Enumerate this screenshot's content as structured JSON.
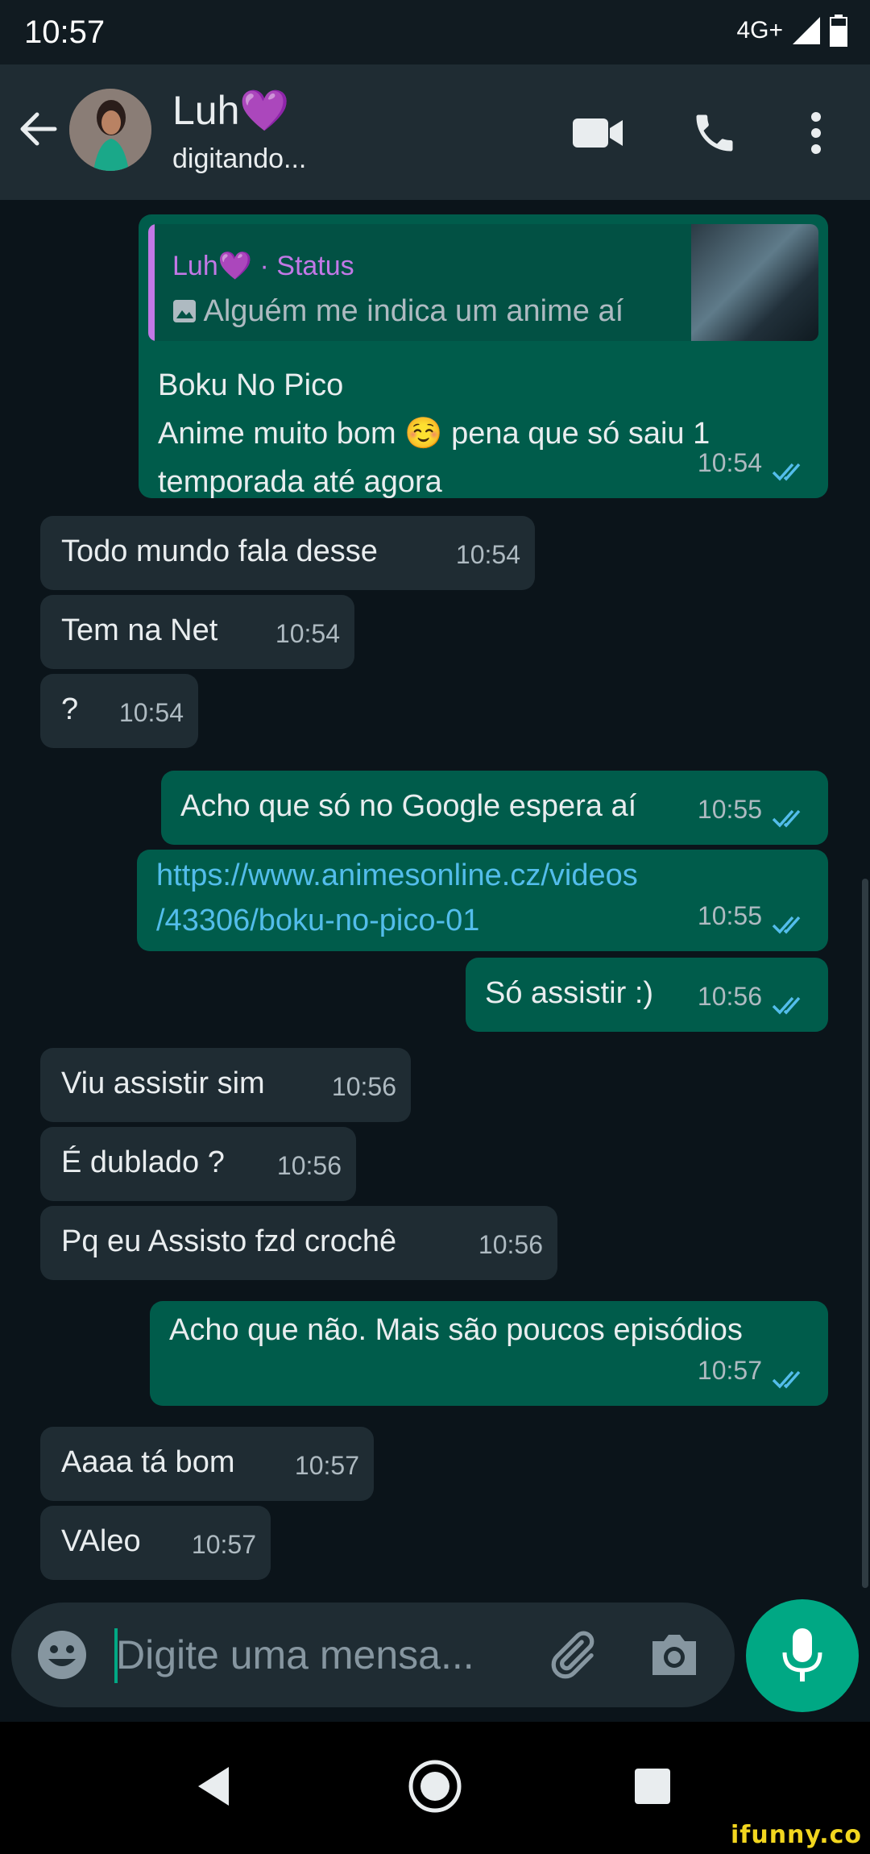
{
  "statusbar": {
    "time": "10:57",
    "network": "4G+"
  },
  "header": {
    "contact_name": "Luh💜",
    "contact_status": "digitando..."
  },
  "quote": {
    "author": "Luh💜 · Status",
    "text": "Alguém me indica um anime aí"
  },
  "messages": [
    {
      "dir": "out",
      "lines": [
        "Boku No Pico",
        "Anime muito bom ☺️ pena que só saiu 1",
        "temporada até agora"
      ],
      "time": "10:54"
    },
    {
      "dir": "in",
      "text": "Todo mundo fala desse",
      "time": "10:54"
    },
    {
      "dir": "in",
      "text": "Tem na Net",
      "time": "10:54"
    },
    {
      "dir": "in",
      "text": "?",
      "time": "10:54"
    },
    {
      "dir": "out",
      "text": "Acho que só no Google espera aí",
      "time": "10:55"
    },
    {
      "dir": "out",
      "lines": [
        "https://www.animesonline.cz/videos",
        "/43306/boku-no-pico-01"
      ],
      "time": "10:55"
    },
    {
      "dir": "out",
      "text": "Só assistir :)",
      "time": "10:56"
    },
    {
      "dir": "in",
      "text": "Viu assistir sim",
      "time": "10:56"
    },
    {
      "dir": "in",
      "text": "É dublado ?",
      "time": "10:56"
    },
    {
      "dir": "in",
      "text": "Pq eu Assisto fzd crochê",
      "time": "10:56"
    },
    {
      "dir": "out",
      "text": "Acho que não. Mais são poucos episódios",
      "time": "10:57"
    },
    {
      "dir": "in",
      "text": "Aaaa tá bom",
      "time": "10:57"
    },
    {
      "dir": "in",
      "text": "VAleo",
      "time": "10:57"
    }
  ],
  "composer": {
    "placeholder": "Digite uma mensa..."
  },
  "watermark": "ifunny.co",
  "colors": {
    "accent": "#00a884",
    "outgoing": "#005c4b",
    "incoming": "#1f2c33",
    "read_ticks": "#53bdeb"
  }
}
